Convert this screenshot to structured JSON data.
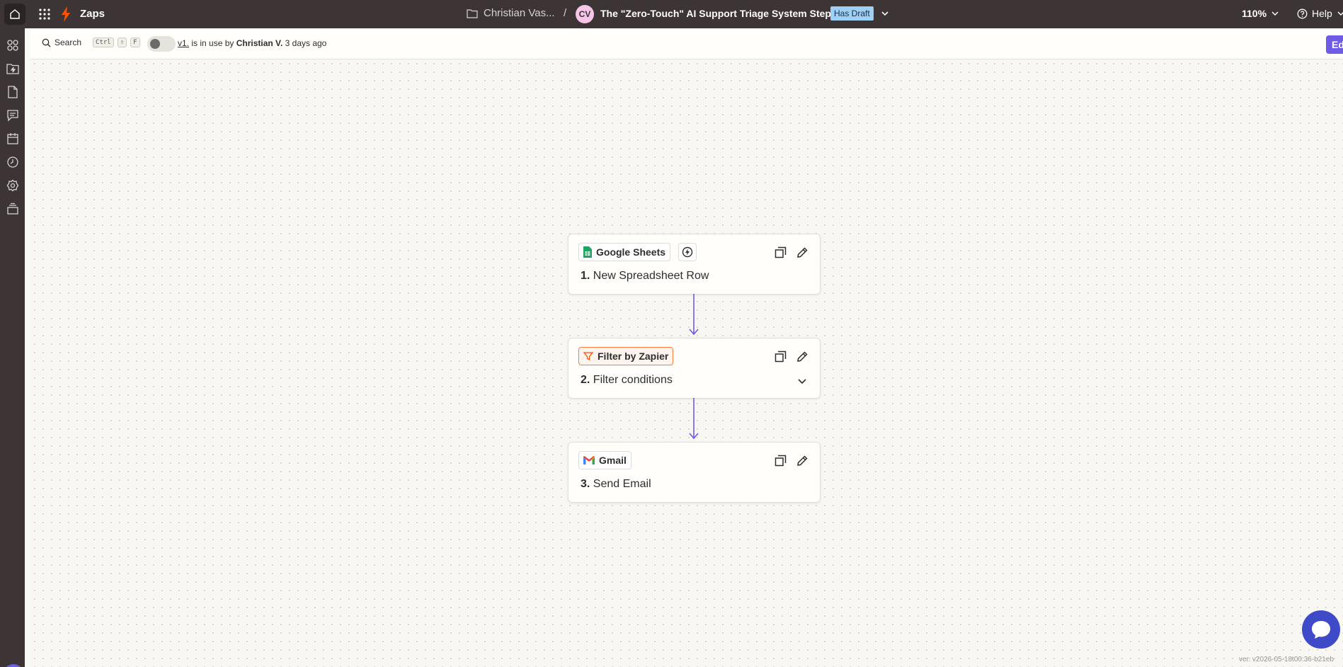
{
  "topbar": {
    "app_name": "Zaps",
    "folder": "Christian Vas...",
    "separator": "/",
    "owner_initials": "CV",
    "zap_title": "The \"Zero-Touch\" AI Support Triage System Step 2",
    "draft_badge": "Has Draft",
    "zoom": "110%",
    "help": "Help"
  },
  "subbar": {
    "search_label": "Search",
    "shortcut_keys": [
      "Ctrl",
      "⇧",
      "F"
    ],
    "version_link": "v1.",
    "usage_text": " is in use by ",
    "user_name": "Christian V.",
    "time_ago": "3 days ago",
    "edit_draft": "Edit draft"
  },
  "steps": [
    {
      "app": "Google Sheets",
      "number": "1.",
      "title": "New Spreadsheet Row"
    },
    {
      "app": "Filter by Zapier",
      "number": "2.",
      "title": "Filter conditions"
    },
    {
      "app": "Gmail",
      "number": "3.",
      "title": "Send Email"
    }
  ],
  "footer": {
    "version": "ver. v2026-05-18t00:36-b21eb"
  },
  "colors": {
    "topbar": "#3d3535",
    "accent": "#6e5be6",
    "connector": "#6e5be6",
    "filter_border": "#ff7a3d",
    "draft_badge": "#9ed0f6",
    "chat_button": "#3f4ac9"
  }
}
